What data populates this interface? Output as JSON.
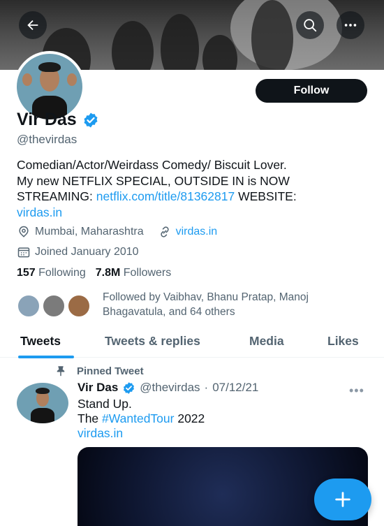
{
  "header": {
    "back_icon": "arrow-left-icon",
    "search_icon": "search-icon",
    "more_icon": "more-horizontal-icon"
  },
  "profile": {
    "name": "Vir Das",
    "verified_icon": "verified-badge-icon",
    "handle": "@thevirdas",
    "follow_label": "Follow",
    "bio_line1": "Comedian/Actor/Weirdass Comedy/ Biscuit Lover.",
    "bio_line2": "My new NETFLIX SPECIAL, OUTSIDE IN is NOW",
    "bio_line3_prefix": "STREAMING: ",
    "bio_link1": "netflix.com/title/81362817",
    "bio_line3_suffix": " WEBSITE:",
    "bio_link2": "virdas.in",
    "location": "Mumbai, Maharashtra",
    "website": "virdas.in",
    "joined": "Joined January 2010",
    "following_count": "157",
    "following_label": "Following",
    "followers_count": "7.8M",
    "followers_label": "Followers",
    "followed_by_line1": "Followed by Vaibhav, Bhanu Pratap, Manoj",
    "followed_by_line2": "Bhagavatula, and 64 others"
  },
  "tabs": [
    {
      "label": "Tweets",
      "active": true
    },
    {
      "label": "Tweets & replies",
      "active": false
    },
    {
      "label": "Media",
      "active": false
    },
    {
      "label": "Likes",
      "active": false
    }
  ],
  "pinned_tweet": {
    "pinned_label": "Pinned Tweet",
    "author_name": "Vir Das",
    "author_handle": "@thevirdas",
    "separator": "·",
    "date": "07/12/21",
    "line1": "Stand Up.",
    "line2_prefix": "The ",
    "hashtag": "#WantedTour",
    "line2_suffix": " 2022",
    "link": "virdas.in"
  },
  "colors": {
    "accent": "#1d9bf0",
    "text_primary": "#0f1419",
    "text_secondary": "#536471"
  },
  "fab_icon": "compose-plus-icon"
}
